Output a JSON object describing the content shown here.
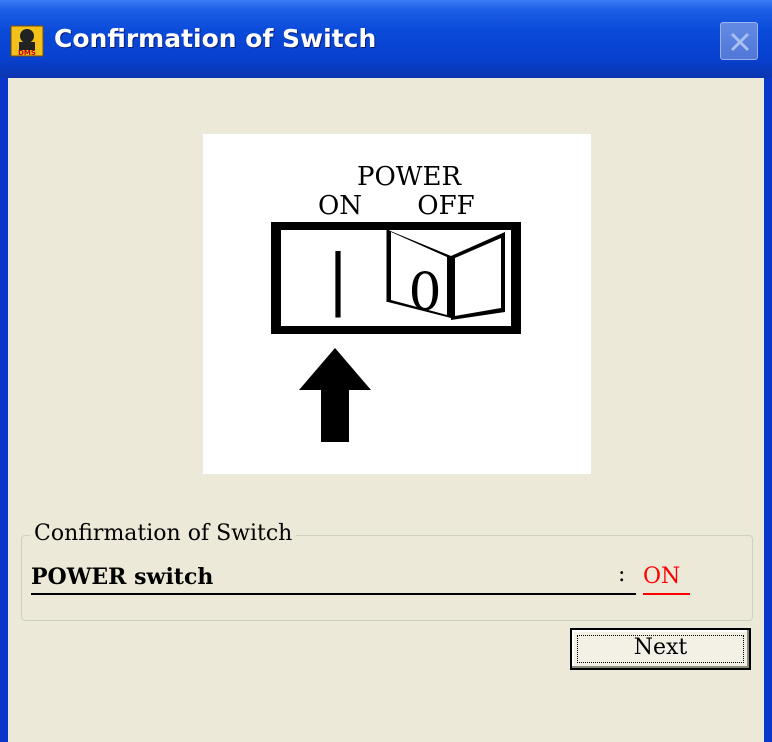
{
  "window": {
    "title": "Confirmation of Switch",
    "app_icon": "diagnostic-app-icon",
    "close_icon": "close-icon"
  },
  "illustration": {
    "power_label": "POWER",
    "on_label": "ON",
    "off_label": "OFF",
    "on_symbol": "|",
    "off_symbol": "0",
    "arrow_icon": "up-arrow-icon",
    "switch_position": "ON"
  },
  "group": {
    "legend": "Confirmation of Switch",
    "row_label": "POWER switch",
    "separator": ":",
    "row_value": "ON",
    "value_color": "#ff0000"
  },
  "buttons": {
    "next_label": "Next"
  }
}
